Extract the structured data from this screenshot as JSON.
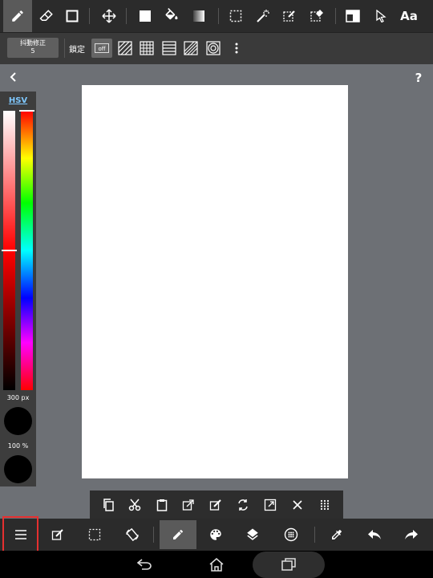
{
  "top_toolbar": {
    "tools": [
      "pencil-icon",
      "eraser-icon",
      "rectangle-icon",
      "move-icon",
      "fill-square-icon",
      "bucket-icon",
      "gradient-icon",
      "selection-icon",
      "magic-wand-icon",
      "selection-pen-icon",
      "selection-eraser-icon",
      "layout-icon",
      "cursor-icon",
      "text-tool-icon"
    ],
    "text_tool_label": "Aa"
  },
  "sub_toolbar": {
    "stabilizer_label": "抖動修正",
    "stabilizer_value": "5",
    "lock_label": "鎖定",
    "snap_off_label": "off"
  },
  "help_label": "?",
  "color_panel": {
    "mode_label": "HSV",
    "brush_size": "300 px",
    "opacity": "100 %",
    "current_color": "#000000"
  },
  "colors": {
    "toolbar_bg": "#2b2b2b",
    "workspace_bg": "#6d7075",
    "highlight": "#e53030"
  }
}
